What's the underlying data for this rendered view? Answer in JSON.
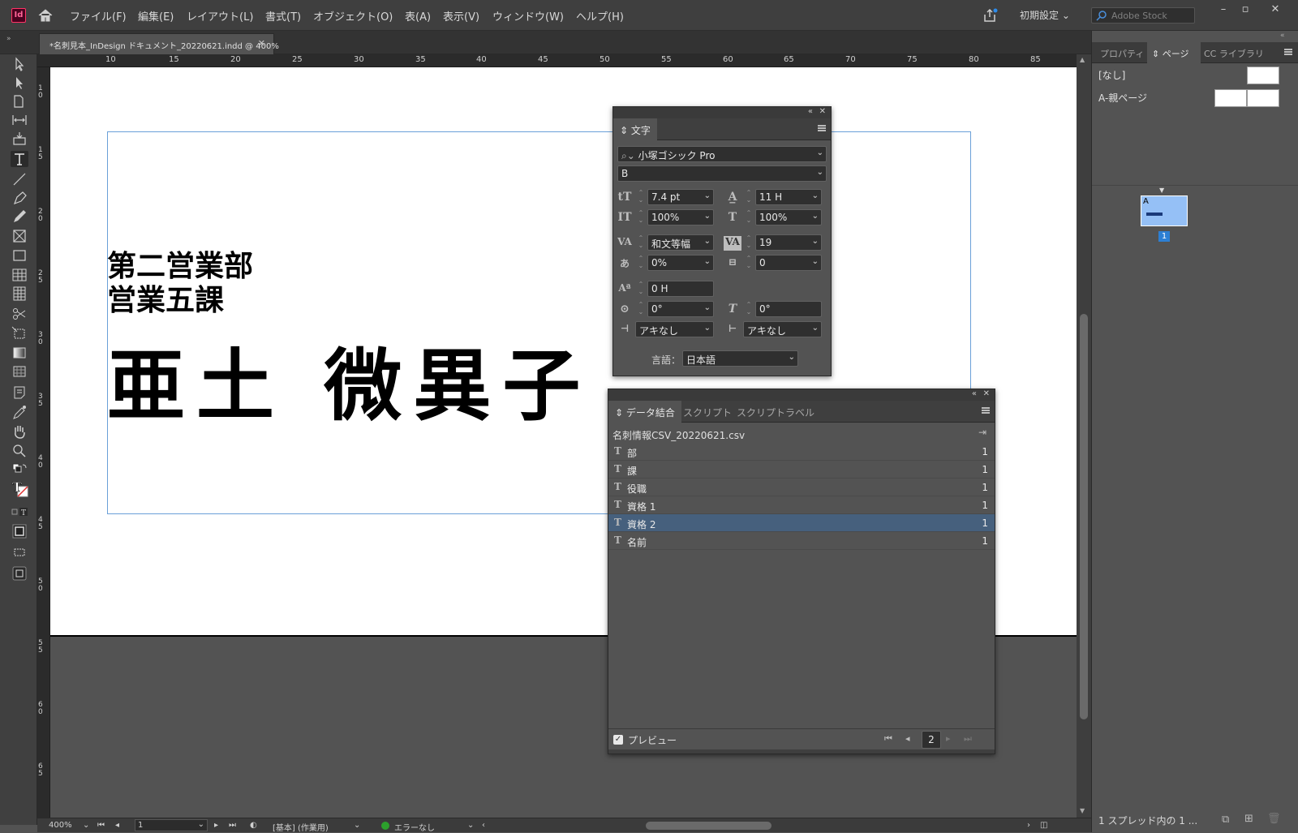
{
  "app": {
    "logo": "Id"
  },
  "menu": [
    "ファイル(F)",
    "編集(E)",
    "レイアウト(L)",
    "書式(T)",
    "オブジェクト(O)",
    "表(A)",
    "表示(V)",
    "ウィンドウ(W)",
    "ヘルプ(H)"
  ],
  "workspace": {
    "label": "初期設定"
  },
  "stock_search": {
    "placeholder": "Adobe Stock"
  },
  "document_tab": {
    "title": "*名刺見本_InDesign ドキュメント_20220621.indd @ 400%",
    "close": "✕"
  },
  "ruler": {
    "top_ticks": [
      "10",
      "15",
      "20",
      "25",
      "30",
      "35",
      "40",
      "45",
      "50",
      "55",
      "60",
      "65",
      "70",
      "75",
      "80",
      "85"
    ],
    "left_ticks": [
      "10",
      "15",
      "20",
      "25",
      "30",
      "35",
      "40",
      "45",
      "50",
      "55",
      "60",
      "65"
    ]
  },
  "page_content": {
    "department": "第二営業部\n営業五課",
    "name": "亜土 微異子"
  },
  "status_bar": {
    "zoom": "400%",
    "page": "1",
    "profile": "[基本] (作業用)",
    "errors": "エラーなし",
    "ok_color": "#2ca02c"
  },
  "dock": {
    "tabs": [
      "プロパティ",
      "ページ",
      "CC ライブラリ"
    ],
    "active_tab": "ページ",
    "masters": [
      "[なし]",
      "A-親ページ"
    ],
    "page_thumb_label": "A",
    "page_number": "1",
    "status": "1 スプレッド内の 1 ..."
  },
  "character_panel": {
    "tab": "文字",
    "font_family": "小塚ゴシック Pro",
    "font_style": "B",
    "font_size": "7.4 pt",
    "leading": "11 H",
    "vertical_scale": "100%",
    "horizontal_scale": "100%",
    "kerning": "和文等幅",
    "tracking": "19",
    "tsume": "0%",
    "grid_count": "0",
    "baseline_shift": "0 H",
    "character_rotation": "0°",
    "skew": "0°",
    "aki_before": "アキなし",
    "aki_after": "アキなし",
    "language_label": "言語：",
    "language": "日本語"
  },
  "data_merge_panel": {
    "tabs": [
      "データ結合",
      "スクリプト",
      "スクリプトラベル"
    ],
    "active_tab": "データ結合",
    "source_file": "名刺情報CSV_20220621.csv",
    "fields": [
      {
        "name": "部",
        "count": "1"
      },
      {
        "name": "課",
        "count": "1"
      },
      {
        "name": "役職",
        "count": "1"
      },
      {
        "name": "資格 1",
        "count": "1"
      },
      {
        "name": "資格 2",
        "count": "1"
      },
      {
        "name": "名前",
        "count": "1"
      }
    ],
    "selected_field": "資格 2",
    "preview_label": "プレビュー",
    "record": "2"
  },
  "colors": {
    "selection": "#46607d",
    "page_thumb": "#95c0f6",
    "accent": "#2d7fd3"
  }
}
